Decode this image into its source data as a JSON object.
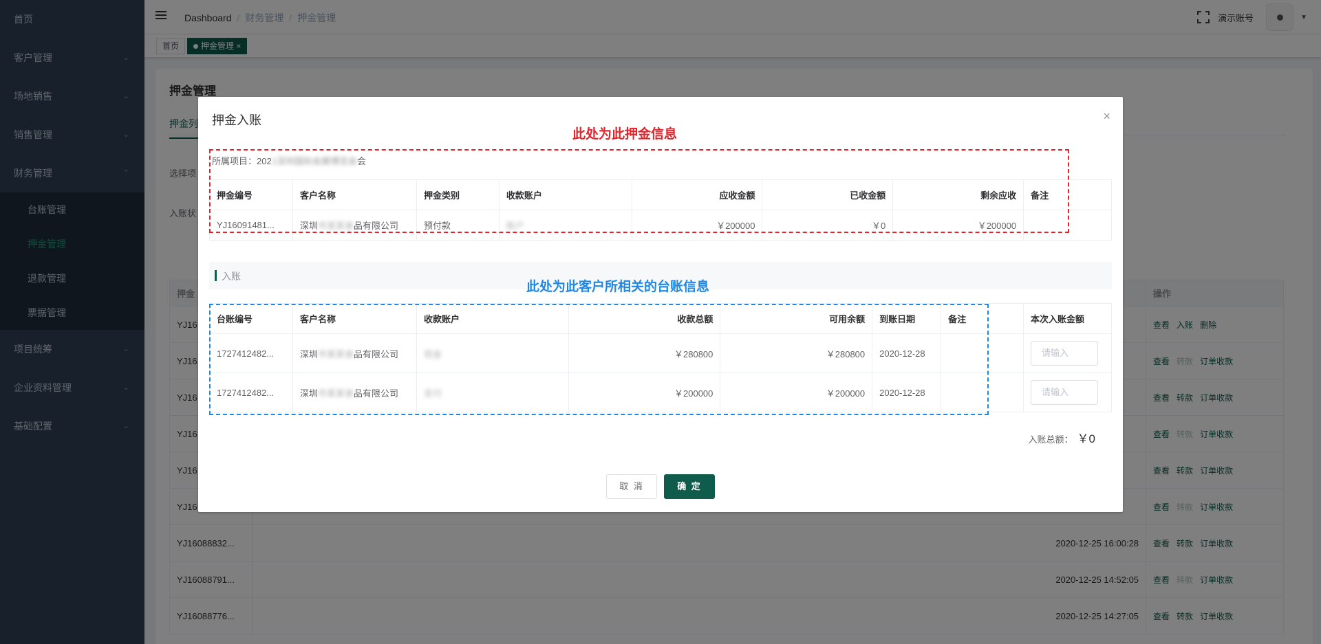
{
  "sidebar": {
    "items": [
      {
        "label": "首页"
      },
      {
        "label": "客户管理"
      },
      {
        "label": "场地销售"
      },
      {
        "label": "销售管理"
      },
      {
        "label": "财务管理"
      }
    ],
    "finance_sub": [
      {
        "label": "台账管理"
      },
      {
        "label": "押金管理"
      },
      {
        "label": "退款管理"
      },
      {
        "label": "票据管理"
      }
    ],
    "more_items": [
      {
        "label": "项目统筹"
      },
      {
        "label": "企业资料管理"
      },
      {
        "label": "基础配置"
      }
    ]
  },
  "header": {
    "breadcrumb": [
      "Dashboard",
      "财务管理",
      "押金管理"
    ],
    "user_name": "演示账号"
  },
  "tags": {
    "home": "首页",
    "active": "押金管理",
    "close": "×"
  },
  "page": {
    "title": "押金管理",
    "sub_tab": "押金列",
    "filter1": "选择项",
    "filter2": "入账状",
    "bg_header_first": "押金",
    "bg_header_op": "操作",
    "bg_rows": [
      {
        "id": "YJ16",
        "time": "",
        "ops": [
          "查看",
          "入账",
          "删除"
        ]
      },
      {
        "id": "YJ16",
        "time": "",
        "ops": [
          "查看",
          "转款",
          "订单收款"
        ]
      },
      {
        "id": "YJ16",
        "time": "",
        "ops": [
          "查看",
          "转款",
          "订单收款"
        ]
      },
      {
        "id": "YJ16",
        "time": "",
        "ops": [
          "查看",
          "转款",
          "订单收款"
        ]
      },
      {
        "id": "YJ16",
        "time": "",
        "ops": [
          "查看",
          "转款",
          "订单收款"
        ]
      },
      {
        "id": "YJ16",
        "time": "",
        "ops": [
          "查看",
          "转款",
          "订单收款"
        ]
      },
      {
        "id": "YJ16088832...",
        "time": "2020-12-25 16:00:28",
        "ops": [
          "查看",
          "转款",
          "订单收款"
        ]
      },
      {
        "id": "YJ16088791...",
        "time": "2020-12-25 14:52:05",
        "ops": [
          "查看",
          "转款",
          "订单收款"
        ]
      },
      {
        "id": "YJ16088776...",
        "time": "2020-12-25 14:27:05",
        "ops": [
          "查看",
          "转款",
          "订单收款"
        ]
      }
    ]
  },
  "modal": {
    "title": "押金入账",
    "close": "×",
    "project_label": "所属项目：",
    "project_prefix": "202",
    "project_suffix": "会",
    "deposit_table": {
      "headers": [
        "押金编号",
        "客户名称",
        "押金类别",
        "收款账户",
        "应收金额",
        "已收金额",
        "剩余应收",
        "备注"
      ],
      "row": {
        "id": "YJ16091481...",
        "customer_prefix": "深圳",
        "customer_suffix": "品有限公司",
        "type": "预付款",
        "account": "",
        "receivable": "￥200000",
        "received": "￥0",
        "remaining": "￥200000",
        "remark": ""
      }
    },
    "section_title": "入账",
    "ledger_table": {
      "headers": [
        "台账编号",
        "客户名称",
        "收款账户",
        "收款总额",
        "可用余额",
        "到账日期",
        "备注",
        "本次入账金额"
      ],
      "rows": [
        {
          "id": "1727412482...",
          "customer_prefix": "深圳",
          "customer_suffix": "品有限公司",
          "account": "",
          "total": "￥280800",
          "available": "￥280800",
          "date": "2020-12-28",
          "remark": "",
          "input_placeholder": "请输入"
        },
        {
          "id": "1727412482...",
          "customer_prefix": "深圳",
          "customer_suffix": "品有限公司",
          "account": "",
          "total": "￥200000",
          "available": "￥200000",
          "date": "2020-12-28",
          "remark": "",
          "input_placeholder": "请输入"
        }
      ]
    },
    "total_label": "入账总额：",
    "total_value": "￥0",
    "cancel_label": "取 消",
    "ok_label": "确 定"
  },
  "annotations": {
    "red_text": "此处为此押金信息",
    "blue_text": "此处为此客户所相关的台账信息",
    "red_color": "#e5232b",
    "blue_color": "#1e88e5"
  },
  "colors": {
    "sidebar_bg": "#304156",
    "accent": "#0f5c4c"
  }
}
